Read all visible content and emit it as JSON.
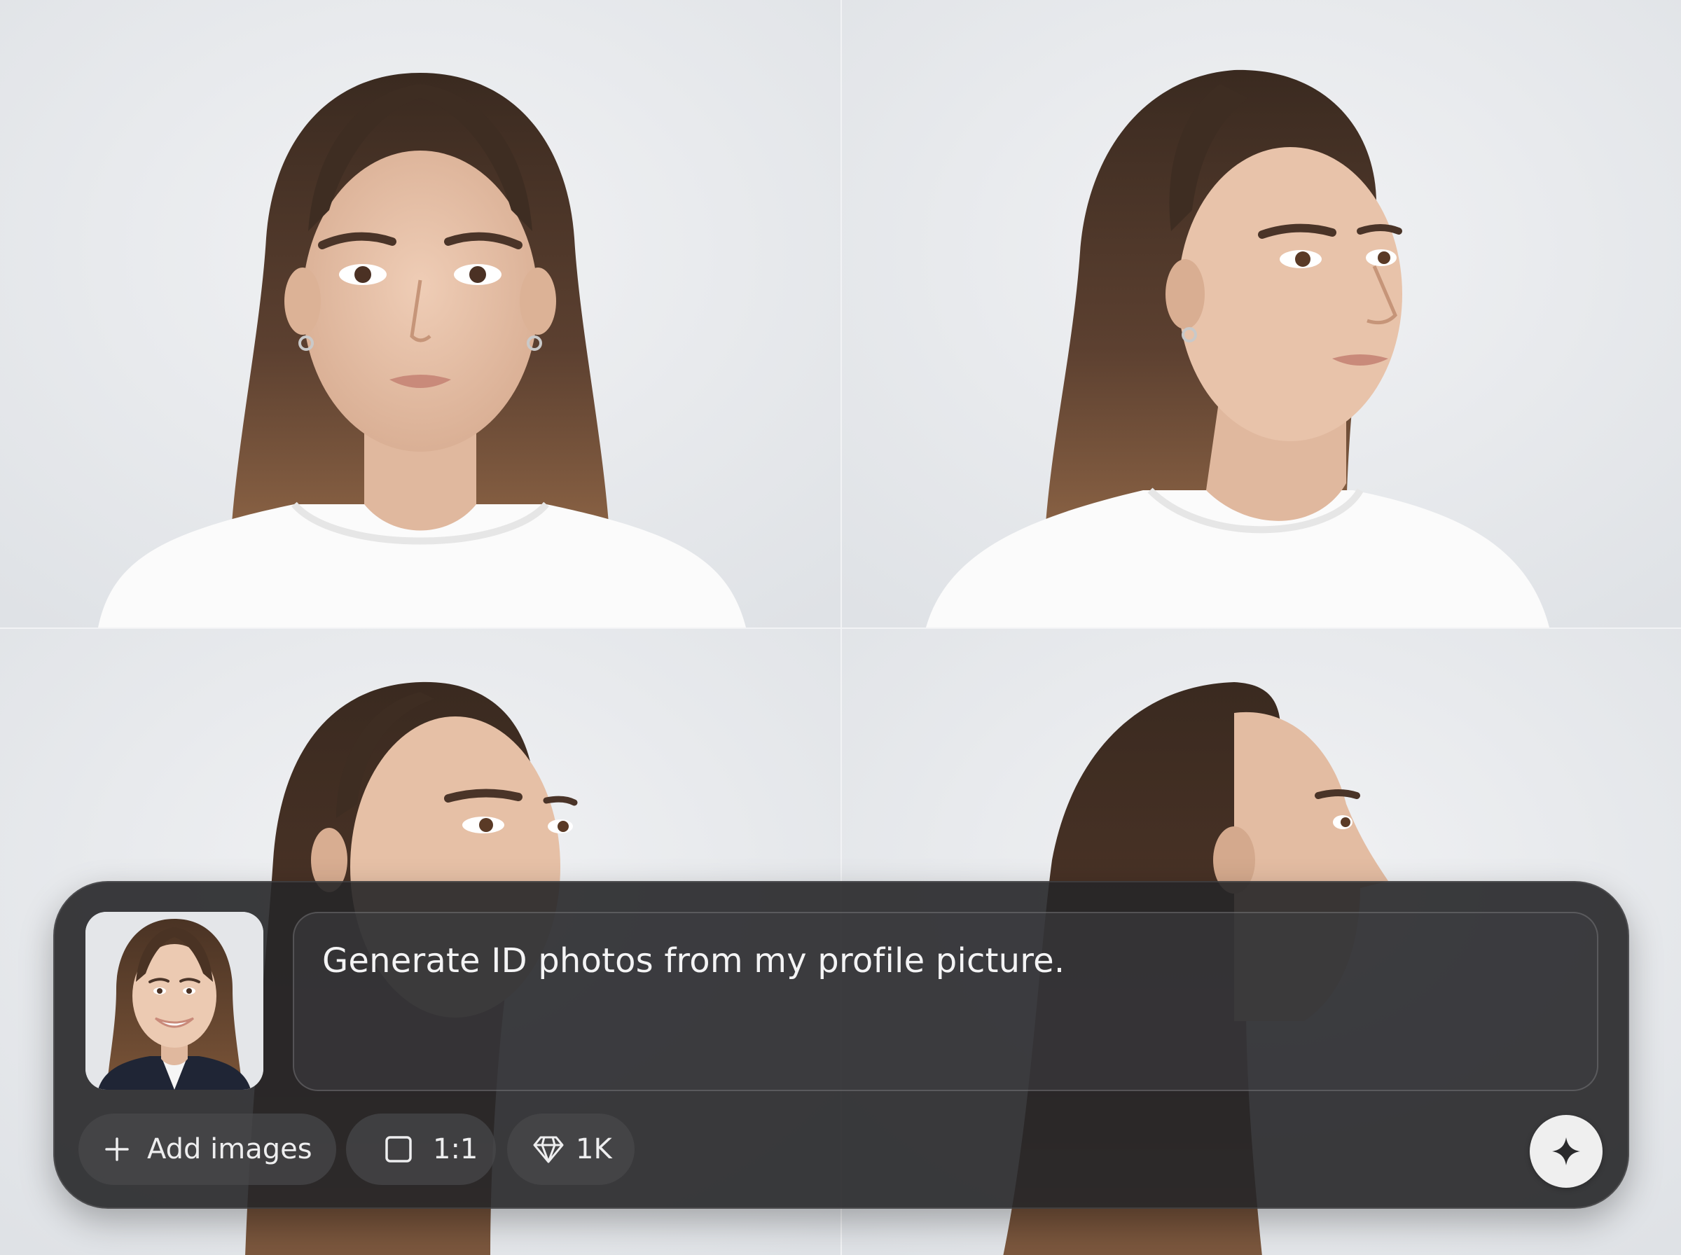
{
  "prompt": {
    "text": "Generate ID photos from my profile picture."
  },
  "toolbar": {
    "add_images_label": "Add images",
    "aspect_ratio_label": "1:1",
    "resolution_label": "1K"
  },
  "icons": {
    "add": "plus-icon",
    "aspect_ratio": "square-icon",
    "resolution": "diamond-icon",
    "send": "sparkle-icon"
  },
  "colors": {
    "panel_background": "#262628",
    "send_button": "#efefef",
    "text": "#f4f4f5"
  }
}
